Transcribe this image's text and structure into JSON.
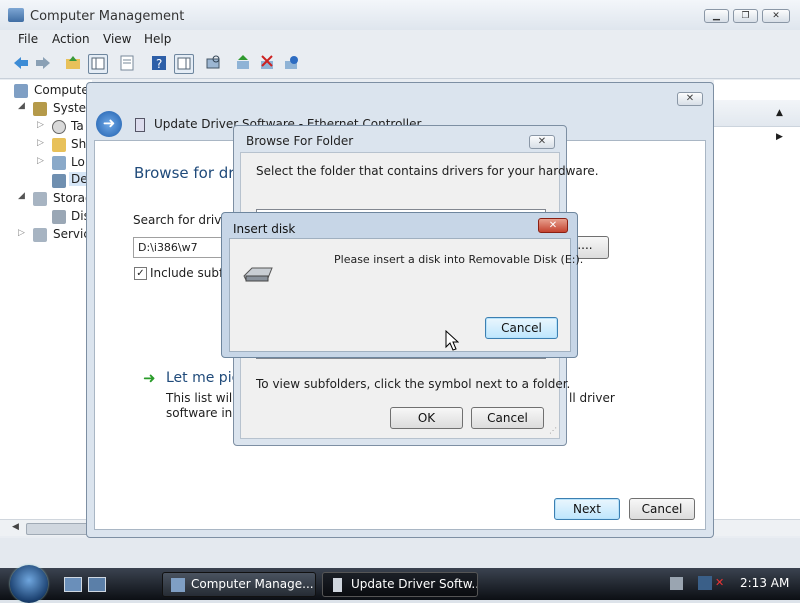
{
  "computer_management": {
    "title": "Computer Management",
    "menu": [
      "File",
      "Action",
      "View",
      "Help"
    ],
    "tree": [
      {
        "label": "Computer",
        "level": 0
      },
      {
        "label": "System",
        "level": 1
      },
      {
        "label": "Ta",
        "level": 2
      },
      {
        "label": "Sh",
        "level": 2
      },
      {
        "label": "Lo",
        "level": 2
      },
      {
        "label": "De",
        "level": 2
      },
      {
        "label": "Storage",
        "level": 1
      },
      {
        "label": "Dis",
        "level": 2
      },
      {
        "label": "Service",
        "level": 1
      }
    ]
  },
  "update_driver": {
    "title": "Update Driver Software - Ethernet Controller",
    "heading": "Browse for driv",
    "search_label": "Search for driver",
    "path_value": "D:\\i386\\w7",
    "include_subfolders_label": "Include subfol",
    "let_me_pick": "Let me pic",
    "description_line1": "This list will s",
    "description_line1_tail": "ll driver",
    "description_line2": "software in th",
    "next_label": "Next",
    "cancel_label": "Cancel",
    "browse_button_label": "...."
  },
  "browse_folder": {
    "title": "Browse For Folder",
    "instruction": "Select the folder that contains drivers for your hardware.",
    "hint": "To view subfolders, click the symbol next to a folder.",
    "ok_label": "OK",
    "cancel_label": "Cancel"
  },
  "insert_disk": {
    "title": "Insert disk",
    "message": "Please insert a disk into Removable Disk (E:).",
    "cancel_label": "Cancel",
    "close_label": "✕"
  },
  "taskbar": {
    "tasks": [
      {
        "label": "Computer Manage..."
      },
      {
        "label": "Update Driver Softw..."
      }
    ],
    "clock": "2:13 AM"
  },
  "colors": {
    "accent": "#3c7fb1",
    "link_green": "#2a9c2a",
    "heading_blue": "#1f4a7a",
    "close_red": "#c44330"
  },
  "icons": {
    "back": "arrow-left-icon",
    "forward": "arrow-right-icon",
    "folder_up": "folder-up-icon",
    "disk": "removable-disk-icon",
    "start": "windows-orb-icon"
  }
}
